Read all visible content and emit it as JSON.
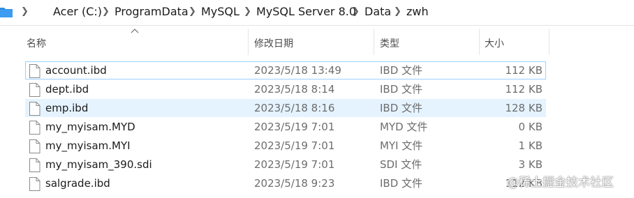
{
  "breadcrumb": [
    "Acer (C:)",
    "ProgramData",
    "MySQL",
    "MySQL Server 8.0",
    "Data",
    "zwh"
  ],
  "columns": {
    "name": "名称",
    "date": "修改日期",
    "type": "类型",
    "size": "大小"
  },
  "files": [
    {
      "name": "account.ibd",
      "date": "2023/5/18 13:49",
      "type": "IBD 文件",
      "size": "112 KB"
    },
    {
      "name": "dept.ibd",
      "date": "2023/5/18 8:14",
      "type": "IBD 文件",
      "size": "112 KB"
    },
    {
      "name": "emp.ibd",
      "date": "2023/5/18 8:16",
      "type": "IBD 文件",
      "size": "128 KB"
    },
    {
      "name": "my_myisam.MYD",
      "date": "2023/5/19 7:01",
      "type": "MYD 文件",
      "size": "0 KB"
    },
    {
      "name": "my_myisam.MYI",
      "date": "2023/5/19 7:01",
      "type": "MYI 文件",
      "size": "1 KB"
    },
    {
      "name": "my_myisam_390.sdi",
      "date": "2023/5/19 7:01",
      "type": "SDI 文件",
      "size": "3 KB"
    },
    {
      "name": "salgrade.ibd",
      "date": "2023/5/18 9:23",
      "type": "IBD 文件",
      "size": "112 KB"
    }
  ],
  "watermark": "@稀土掘金技术社区",
  "icons": {
    "folder": "folder-icon",
    "chevron": "chevron-right-icon",
    "file": "file-icon",
    "sort": "sort-ascending-icon"
  },
  "colors": {
    "selection": "#e5f3ff",
    "focus_border": "#99d1ff",
    "folder": "#2f8fe0"
  }
}
